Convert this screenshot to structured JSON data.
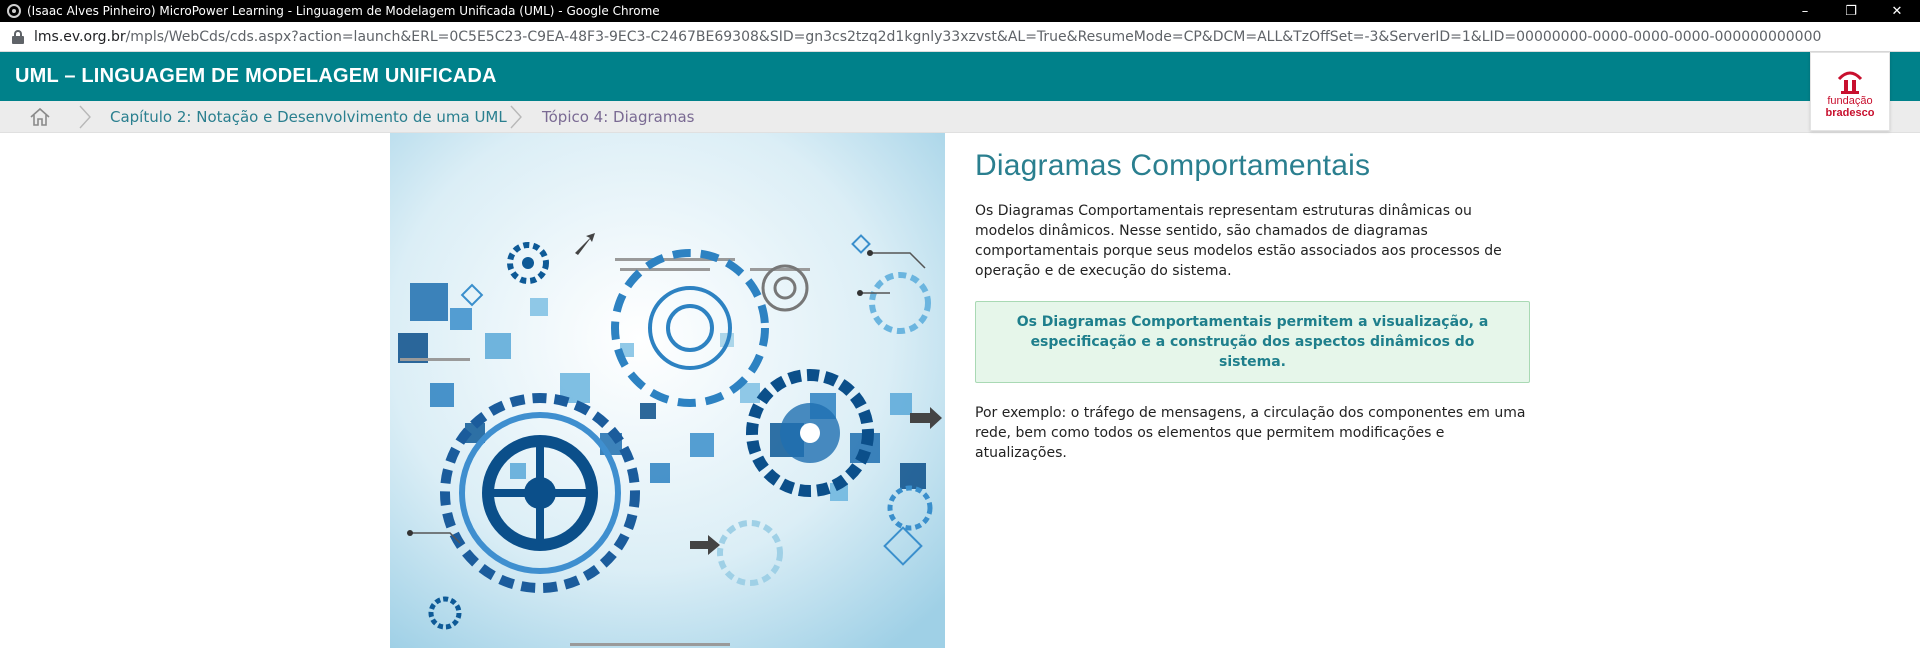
{
  "browser": {
    "window_title": "(Isaac Alves Pinheiro) MicroPower Learning - Linguagem de Modelagem Unificada (UML) - Google Chrome",
    "url_host": "lms.ev.org.br",
    "url_path": "/mpls/WebCds/cds.aspx?action=launch&ERL=0C5E5C23-C9EA-48F3-9EC3-C2467BE69308&SID=gn3cs2tzq2d1kgnly33xzvst&AL=True&ResumeMode=CP&DCM=ALL&TzOffSet=-3&ServerID=1&LID=00000000-0000-0000-0000-000000000000",
    "controls": {
      "minimize": "–",
      "restore": "❐",
      "close": "✕"
    }
  },
  "header": {
    "course_title": "UML – LINGUAGEM DE MODELAGEM UNIFICADA",
    "bg_color": "#00818a"
  },
  "breadcrumb": {
    "home_icon": "home-icon",
    "chapter": "Capítulo 2: Notação e Desenvolvimento de uma UML",
    "topic": "Tópico 4: Diagramas"
  },
  "logo": {
    "line1": "fundação",
    "line2": "bradesco",
    "color": "#c8102e"
  },
  "hero": {
    "icon": "gears-illustration"
  },
  "main": {
    "title": "Diagramas Comportamentais",
    "paragraph1": "Os Diagramas Comportamentais representam estruturas dinâmicas ou modelos dinâmicos. Nesse sentido, são chamados de diagramas comportamentais porque seus modelos estão associados aos processos de operação e de execução do sistema.",
    "highlight": "Os Diagramas Comportamentais permitem a visualização, a especificação e a construção dos aspectos dinâmicos do sistema.",
    "paragraph2": "Por exemplo: o tráfego de mensagens, a circulação dos componentes em uma rede, bem como todos os elementos que permitem modificações e atualizações."
  }
}
